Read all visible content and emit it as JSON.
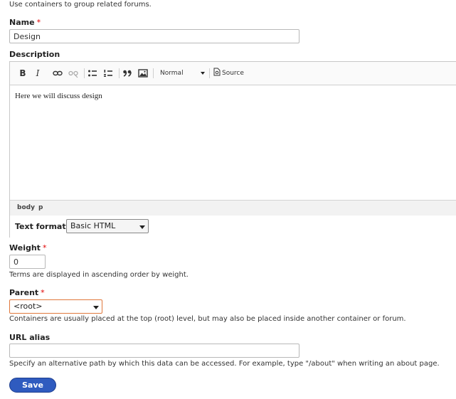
{
  "intro": {
    "text": "Use containers to group related forums."
  },
  "name_field": {
    "label": "Name",
    "required": "*",
    "value": "Design"
  },
  "description": {
    "label": "Description",
    "toolbar": {
      "bold": "B",
      "italic": "I",
      "paragraph_format": "Normal",
      "source": "Source"
    },
    "content": "Here we will discuss design",
    "path": [
      "body",
      "p"
    ],
    "text_format": {
      "label": "Text format",
      "value": "Basic HTML"
    }
  },
  "weight": {
    "label": "Weight",
    "required": "*",
    "value": "0",
    "help": "Terms are displayed in ascending order by weight."
  },
  "parent": {
    "label": "Parent",
    "required": "*",
    "value": "<root>",
    "help": "Containers are usually placed at the top (root) level, but may also be placed inside another container or forum."
  },
  "url_alias": {
    "label": "URL alias",
    "value": "",
    "help": "Specify an alternative path by which this data can be accessed. For example, type \"/about\" when writing an about page."
  },
  "save": {
    "label": "Save"
  },
  "colors": {
    "accent": "#2f5bbf",
    "required": "#e00000",
    "focus_border": "#e0783c"
  }
}
